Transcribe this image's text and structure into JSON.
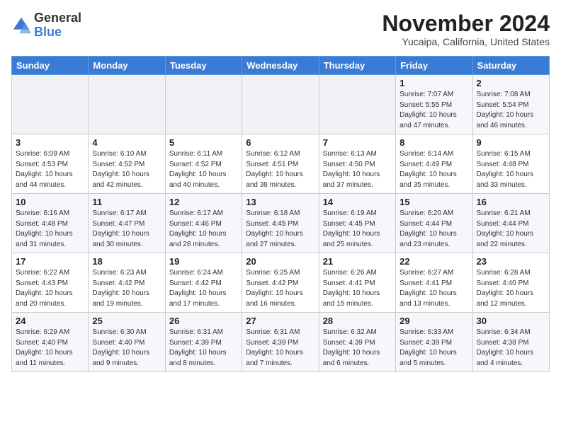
{
  "header": {
    "logo_general": "General",
    "logo_blue": "Blue",
    "month_title": "November 2024",
    "location": "Yucaipa, California, United States"
  },
  "weekdays": [
    "Sunday",
    "Monday",
    "Tuesday",
    "Wednesday",
    "Thursday",
    "Friday",
    "Saturday"
  ],
  "weeks": [
    [
      {
        "day": "",
        "info": ""
      },
      {
        "day": "",
        "info": ""
      },
      {
        "day": "",
        "info": ""
      },
      {
        "day": "",
        "info": ""
      },
      {
        "day": "",
        "info": ""
      },
      {
        "day": "1",
        "info": "Sunrise: 7:07 AM\nSunset: 5:55 PM\nDaylight: 10 hours and 47 minutes."
      },
      {
        "day": "2",
        "info": "Sunrise: 7:08 AM\nSunset: 5:54 PM\nDaylight: 10 hours and 46 minutes."
      }
    ],
    [
      {
        "day": "3",
        "info": "Sunrise: 6:09 AM\nSunset: 4:53 PM\nDaylight: 10 hours and 44 minutes."
      },
      {
        "day": "4",
        "info": "Sunrise: 6:10 AM\nSunset: 4:52 PM\nDaylight: 10 hours and 42 minutes."
      },
      {
        "day": "5",
        "info": "Sunrise: 6:11 AM\nSunset: 4:52 PM\nDaylight: 10 hours and 40 minutes."
      },
      {
        "day": "6",
        "info": "Sunrise: 6:12 AM\nSunset: 4:51 PM\nDaylight: 10 hours and 38 minutes."
      },
      {
        "day": "7",
        "info": "Sunrise: 6:13 AM\nSunset: 4:50 PM\nDaylight: 10 hours and 37 minutes."
      },
      {
        "day": "8",
        "info": "Sunrise: 6:14 AM\nSunset: 4:49 PM\nDaylight: 10 hours and 35 minutes."
      },
      {
        "day": "9",
        "info": "Sunrise: 6:15 AM\nSunset: 4:48 PM\nDaylight: 10 hours and 33 minutes."
      }
    ],
    [
      {
        "day": "10",
        "info": "Sunrise: 6:16 AM\nSunset: 4:48 PM\nDaylight: 10 hours and 31 minutes."
      },
      {
        "day": "11",
        "info": "Sunrise: 6:17 AM\nSunset: 4:47 PM\nDaylight: 10 hours and 30 minutes."
      },
      {
        "day": "12",
        "info": "Sunrise: 6:17 AM\nSunset: 4:46 PM\nDaylight: 10 hours and 28 minutes."
      },
      {
        "day": "13",
        "info": "Sunrise: 6:18 AM\nSunset: 4:45 PM\nDaylight: 10 hours and 27 minutes."
      },
      {
        "day": "14",
        "info": "Sunrise: 6:19 AM\nSunset: 4:45 PM\nDaylight: 10 hours and 25 minutes."
      },
      {
        "day": "15",
        "info": "Sunrise: 6:20 AM\nSunset: 4:44 PM\nDaylight: 10 hours and 23 minutes."
      },
      {
        "day": "16",
        "info": "Sunrise: 6:21 AM\nSunset: 4:44 PM\nDaylight: 10 hours and 22 minutes."
      }
    ],
    [
      {
        "day": "17",
        "info": "Sunrise: 6:22 AM\nSunset: 4:43 PM\nDaylight: 10 hours and 20 minutes."
      },
      {
        "day": "18",
        "info": "Sunrise: 6:23 AM\nSunset: 4:42 PM\nDaylight: 10 hours and 19 minutes."
      },
      {
        "day": "19",
        "info": "Sunrise: 6:24 AM\nSunset: 4:42 PM\nDaylight: 10 hours and 17 minutes."
      },
      {
        "day": "20",
        "info": "Sunrise: 6:25 AM\nSunset: 4:42 PM\nDaylight: 10 hours and 16 minutes."
      },
      {
        "day": "21",
        "info": "Sunrise: 6:26 AM\nSunset: 4:41 PM\nDaylight: 10 hours and 15 minutes."
      },
      {
        "day": "22",
        "info": "Sunrise: 6:27 AM\nSunset: 4:41 PM\nDaylight: 10 hours and 13 minutes."
      },
      {
        "day": "23",
        "info": "Sunrise: 6:28 AM\nSunset: 4:40 PM\nDaylight: 10 hours and 12 minutes."
      }
    ],
    [
      {
        "day": "24",
        "info": "Sunrise: 6:29 AM\nSunset: 4:40 PM\nDaylight: 10 hours and 11 minutes."
      },
      {
        "day": "25",
        "info": "Sunrise: 6:30 AM\nSunset: 4:40 PM\nDaylight: 10 hours and 9 minutes."
      },
      {
        "day": "26",
        "info": "Sunrise: 6:31 AM\nSunset: 4:39 PM\nDaylight: 10 hours and 8 minutes."
      },
      {
        "day": "27",
        "info": "Sunrise: 6:31 AM\nSunset: 4:39 PM\nDaylight: 10 hours and 7 minutes."
      },
      {
        "day": "28",
        "info": "Sunrise: 6:32 AM\nSunset: 4:39 PM\nDaylight: 10 hours and 6 minutes."
      },
      {
        "day": "29",
        "info": "Sunrise: 6:33 AM\nSunset: 4:39 PM\nDaylight: 10 hours and 5 minutes."
      },
      {
        "day": "30",
        "info": "Sunrise: 6:34 AM\nSunset: 4:38 PM\nDaylight: 10 hours and 4 minutes."
      }
    ]
  ]
}
